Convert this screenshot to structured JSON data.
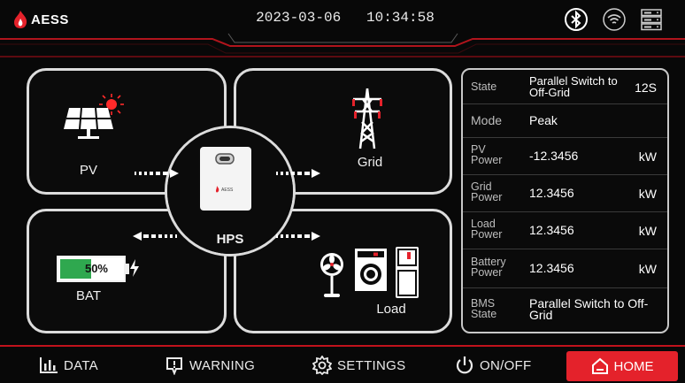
{
  "header": {
    "brand": "AESS",
    "date": "2023-03-06",
    "time": "10:34:58",
    "icons": [
      "bluetooth-icon",
      "wifi-icon",
      "server-icon"
    ]
  },
  "diagram": {
    "pv_label": "PV",
    "grid_label": "Grid",
    "hps_label": "HPS",
    "bat_label": "BAT",
    "battery_percent": "50%",
    "battery_level": 0.5,
    "load_label": "Load",
    "inverter_brand": "AESS"
  },
  "state_table": {
    "rows": [
      {
        "key": "State",
        "value": "Parallel Switch to Off-Grid",
        "unit": "12S"
      },
      {
        "key": "Mode",
        "value": "Peak",
        "unit": ""
      },
      {
        "key": "PV Power",
        "value": "-12.3456",
        "unit": "kW"
      },
      {
        "key": "Grid Power",
        "value": "12.3456",
        "unit": "kW"
      },
      {
        "key": "Load Power",
        "value": "12.3456",
        "unit": "kW"
      },
      {
        "key": "Battery Power",
        "value": "12.3456",
        "unit": "kW"
      },
      {
        "key": "BMS State",
        "value": "Parallel Switch to Off-Grid",
        "unit": ""
      }
    ]
  },
  "nav": {
    "data": "DATA",
    "warning": "WARNING",
    "settings": "SETTINGS",
    "onoff": "ON/OFF",
    "home": "HOME"
  },
  "colors": {
    "accent_red": "#e4222b",
    "battery_green": "#2fa84f",
    "panel_border": "#dcdcdc"
  }
}
